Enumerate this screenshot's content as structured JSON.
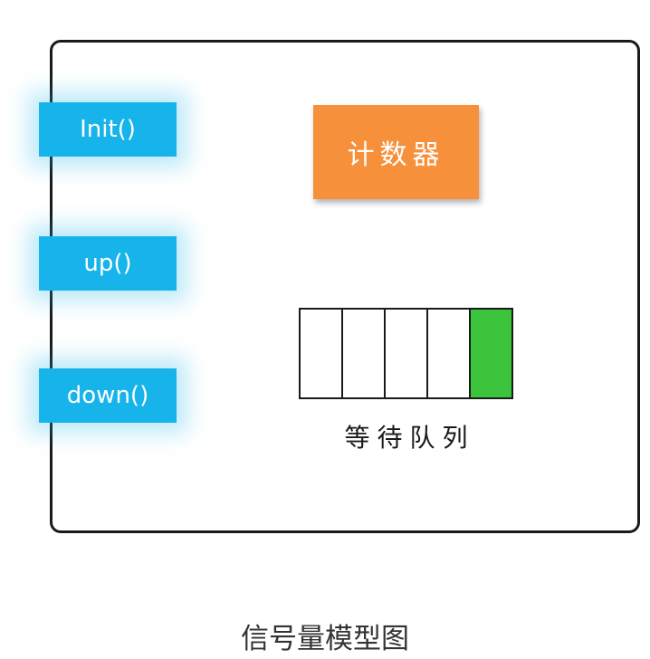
{
  "operations": [
    {
      "label": "Init()"
    },
    {
      "label": "up()"
    },
    {
      "label": "down()"
    }
  ],
  "counter": {
    "label": "计数器"
  },
  "queue": {
    "label": "等待队列",
    "slots": 5,
    "filled_slot": 5
  },
  "caption": "信号量模型图",
  "colors": {
    "operation_button": "#16b4ea",
    "counter_box": "#f7903a",
    "queue_filled": "#3cc43c"
  }
}
